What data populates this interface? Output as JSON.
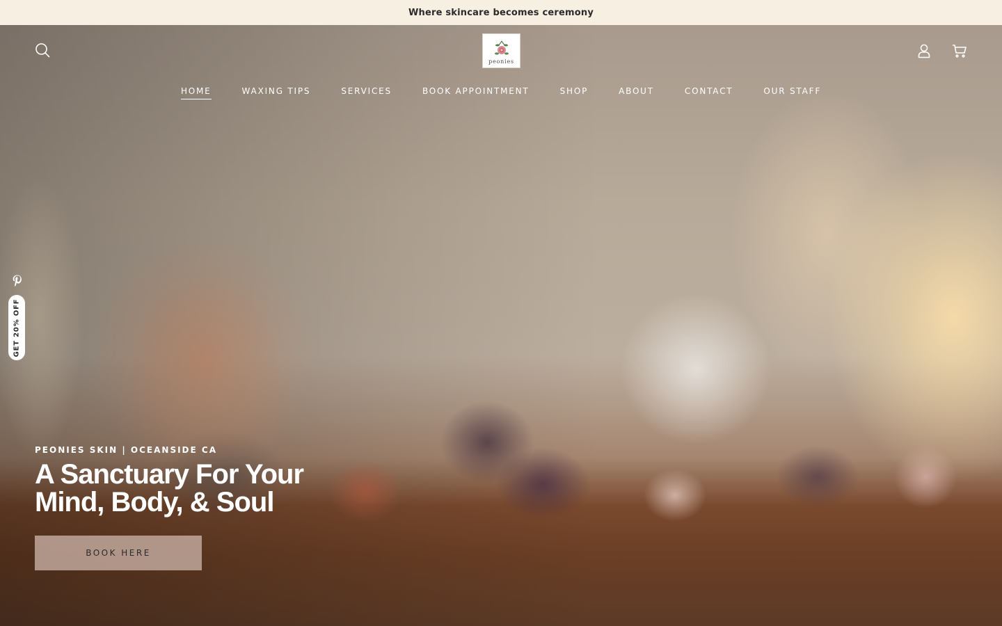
{
  "announcement": {
    "text": "Where skincare becomes ceremony"
  },
  "header": {
    "logo_text": "peonies",
    "icons": {
      "search": "search-icon",
      "account": "user-icon",
      "cart": "cart-icon"
    }
  },
  "nav": {
    "items": [
      {
        "label": "HOME",
        "active": true
      },
      {
        "label": "WAXING TIPS"
      },
      {
        "label": "SERVICES"
      },
      {
        "label": "BOOK APPOINTMENT"
      },
      {
        "label": "SHOP"
      },
      {
        "label": "ABOUT"
      },
      {
        "label": "CONTACT"
      },
      {
        "label": "OUR STAFF"
      }
    ]
  },
  "side": {
    "pinterest_icon": "pinterest-icon",
    "discount_label": "GET 20% OFF"
  },
  "hero": {
    "eyebrow": "PEONIES SKIN | OCEANSIDE CA",
    "headline": "A Sanctuary For Your Mind, Body, & Soul",
    "cta_label": "BOOK HERE"
  },
  "colors": {
    "announcement_bg": "#f6efe2",
    "cta_bg": "#c4aca0",
    "text_dark": "#2b2b2b"
  }
}
